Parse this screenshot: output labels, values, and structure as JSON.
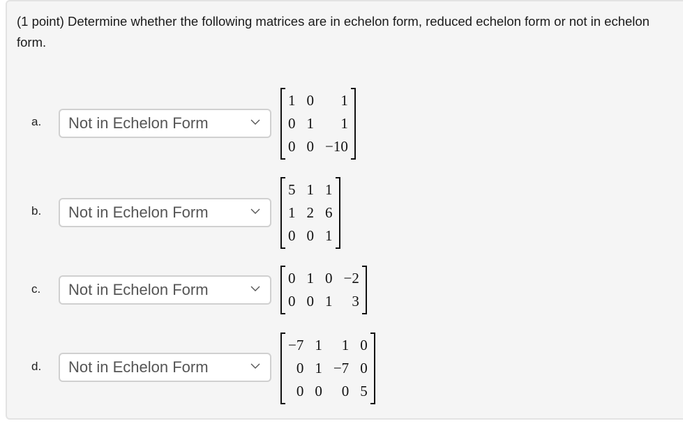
{
  "prompt": "(1 point) Determine whether the following matrices are in echelon form, reduced echelon form or not in echelon form.",
  "items": [
    {
      "label": "a.",
      "selected": "Not in Echelon Form",
      "matrix": [
        [
          "1",
          "0",
          "1"
        ],
        [
          "0",
          "1",
          "1"
        ],
        [
          "0",
          "0",
          "−10"
        ]
      ]
    },
    {
      "label": "b.",
      "selected": "Not in Echelon Form",
      "matrix": [
        [
          "5",
          "1",
          "1"
        ],
        [
          "1",
          "2",
          "6"
        ],
        [
          "0",
          "0",
          "1"
        ]
      ]
    },
    {
      "label": "c.",
      "selected": "Not in Echelon Form",
      "matrix": [
        [
          "0",
          "1",
          "0",
          "−2"
        ],
        [
          "0",
          "0",
          "1",
          "3"
        ]
      ]
    },
    {
      "label": "d.",
      "selected": "Not in Echelon Form",
      "matrix": [
        [
          "−7",
          "1",
          "1",
          "0"
        ],
        [
          "0",
          "1",
          "−7",
          "0"
        ],
        [
          "0",
          "0",
          "0",
          "5"
        ]
      ]
    }
  ],
  "icons": {
    "select_chevron": "chevron-down-icon"
  },
  "colors": {
    "panel_background": "#f5f5f5",
    "panel_border": "#e3e3e3",
    "select_border": "#d0d0d0"
  }
}
